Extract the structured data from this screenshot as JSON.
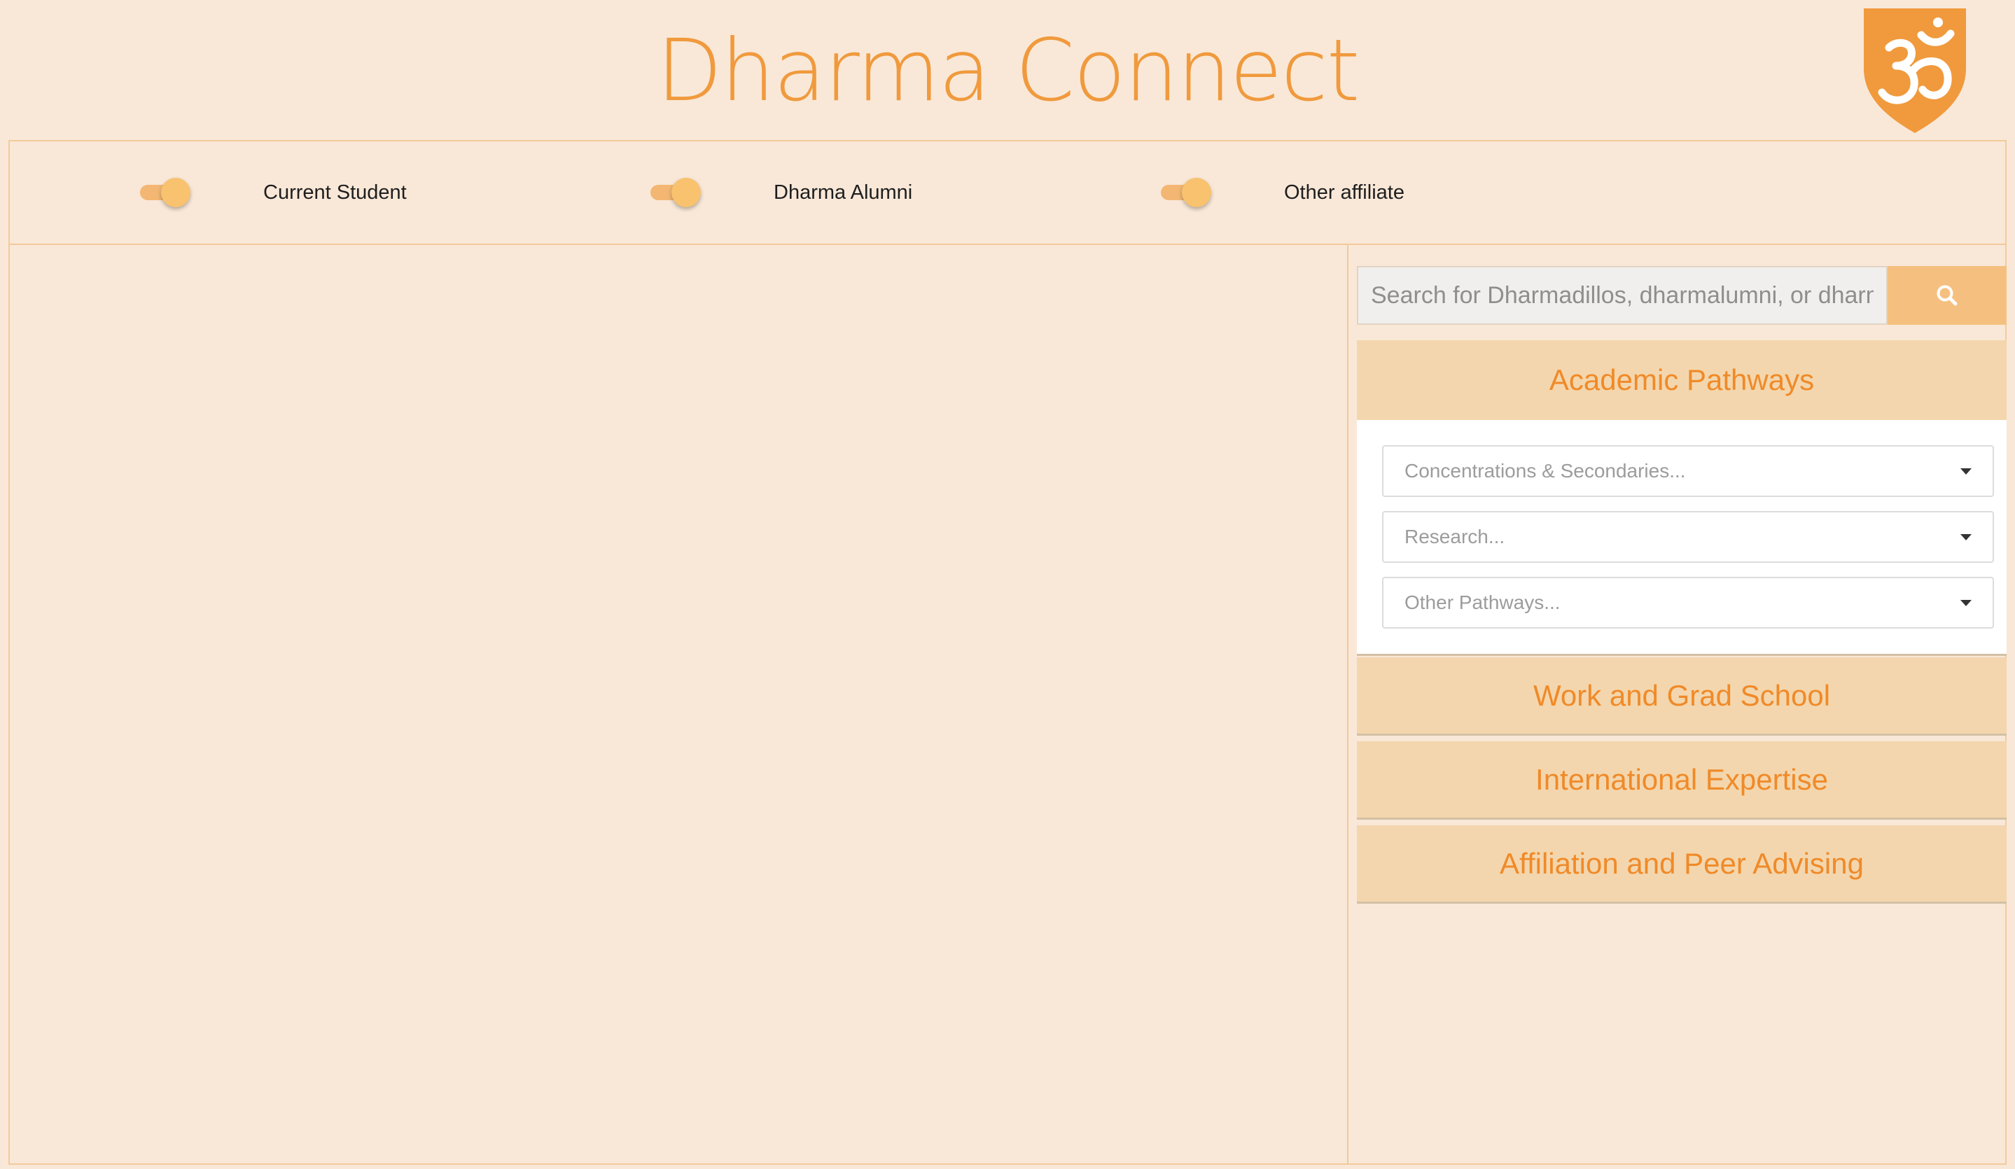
{
  "app": {
    "title": "Dharma Connect",
    "logo_icon": "om-shield-icon",
    "accent_color": "#f09a3d",
    "background_color": "#f9e8d8"
  },
  "filters": [
    {
      "label": "Current Student",
      "enabled": true
    },
    {
      "label": "Dharma Alumni",
      "enabled": true
    },
    {
      "label": "Other affiliate",
      "enabled": true
    }
  ],
  "search": {
    "placeholder": "Search for Dharmadillos, dharmalumni, or dharma affiliates",
    "value": "",
    "button_icon": "search-icon"
  },
  "sidebar": {
    "sections": [
      {
        "title": "Academic Pathways",
        "expanded": true,
        "selects": [
          {
            "placeholder": "Concentrations & Secondaries..."
          },
          {
            "placeholder": "Research..."
          },
          {
            "placeholder": "Other Pathways..."
          }
        ]
      },
      {
        "title": "Work and Grad School",
        "expanded": false
      },
      {
        "title": "International Expertise",
        "expanded": false
      },
      {
        "title": "Affiliation and Peer Advising",
        "expanded": false
      }
    ]
  }
}
